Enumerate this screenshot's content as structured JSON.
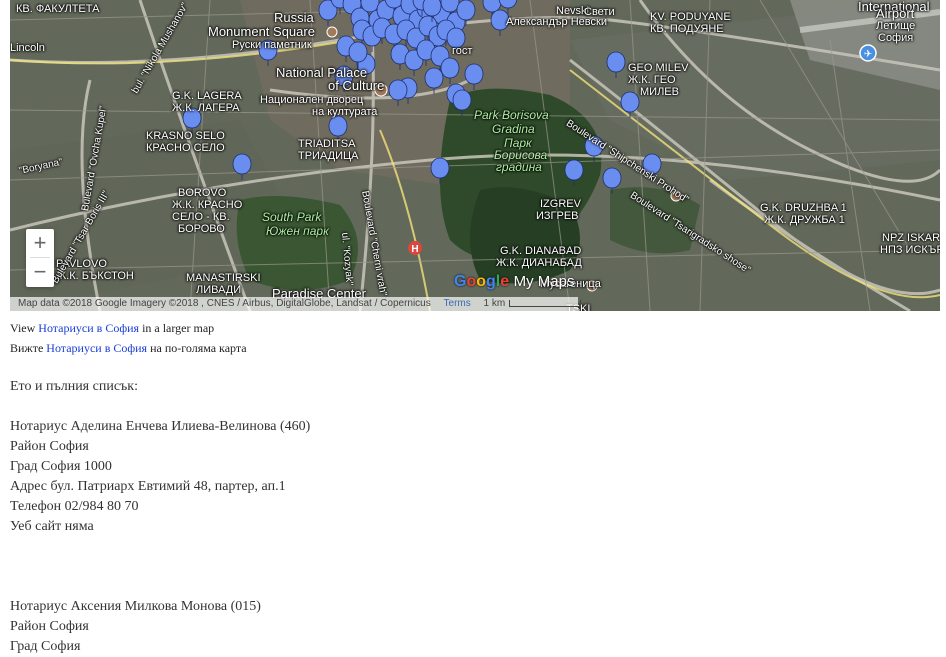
{
  "map": {
    "labels": {
      "fakulteta": "КВ. ФАКУЛТЕТА",
      "russian": "Russia",
      "monument_en": "Monument Square",
      "monument_bg": "Руски паметник",
      "national_palace_en": "National Palace",
      "national_palace_en2": "of Culture",
      "national_palace_bg": "Национален дворец",
      "national_palace_bg2": "на културата",
      "lagera_en": "G.K. LAGERA",
      "lagera_bg": "Ж.К. ЛАГЕРА",
      "krasno_en": "KRASNO SELO",
      "krasno_bg": "КРАСНО СЕЛО",
      "triaditsa_en": "TRIADITSA",
      "triaditsa_bg": "ТРИАДИЦА",
      "borovo_en": "BOROVO",
      "borovo_bg": "Ж.К. КРАСНО",
      "borovo_bg2": "СЕЛО - КВ.",
      "borovo_bg3": "БОРОВО",
      "south_park_en": "South Park",
      "south_park_bg": "Южен парк",
      "pavlovo_en": "PAVLOVO",
      "pavlovo_bg": "Ж.К. БЪКСТОН",
      "manastirski_en": "MANASTIRSKI",
      "manastirski_bg": "ЛИВАДИ",
      "paradise": "Paradise Center",
      "park_borisova_en": "Park Borisova",
      "park_borisova_en2": "Gradina",
      "park_borisova_bg": "Парк",
      "park_borisova_bg2": "Борисова",
      "park_borisova_bg3": "градина",
      "izgrev_en": "IZGREV",
      "izgrev_bg": "ИЗГРЕВ",
      "dianabad_en": "G.K. DIANABAD",
      "dianabad_bg": "Ж.К. ДИАНАБАД",
      "musagenitsa": "Мусагеница",
      "geo_milev_en": "GEO MILEV",
      "geo_milev_bg": "Ж.К. ГЕО",
      "geo_milev_bg2": "МИЛЕВ",
      "poduyane_en": "KV. PODUYANE",
      "poduyane_bg": "КВ. ПОДУЯНЕ",
      "druzhba_en": "G.K. DRUZHBA 1",
      "druzhba_bg": "Ж.К. ДРУЖБА 1",
      "nevski": "Александър Невски",
      "sveti": "Свети",
      "nevski_en": "Nevski",
      "airport_en": "International",
      "airport_en2": "Airport",
      "airport_bg": "Летище",
      "airport_bg2": "София",
      "npz_en": "NPZ ISKAR",
      "npz_bg": "НПЗ ИСКЪР",
      "shipchenski": "Boulevard \"Shipchenski Prohod\"",
      "tsarigradsko": "Boulevard \"Tsarigradsko shose\"",
      "cherni_vrah": "Boulevard \"Cherni vrah\"",
      "kozyak": "ul. \"Kozyak\"",
      "tsar_boris": "Bulevard \"Tsar Boris III\"",
      "boryana": "\"Boryana\"",
      "ovcha_kupel": "Bulevard \"Ovcha Kupel\"",
      "nikola_mushanov": "bul. \"Nikola Mushanov\"",
      "gost": "гост",
      "tsktisk": "TSKI",
      "lincoln": "Lincoln"
    },
    "zoom_in": "+",
    "zoom_out": "−",
    "attribution": "Map data ©2018 Google Imagery ©2018 , CNES / Airbus, DigitalGlobe, Landsat / Copernicus",
    "terms": "Terms",
    "scale": "1 km",
    "logo_google": [
      "G",
      "o",
      "o",
      "g",
      "l",
      "e"
    ],
    "logo_mymaps": "My Maps",
    "accent_pin": "#6a8df0"
  },
  "links": {
    "line1_prefix": "View",
    "line1_link": "Нотариуси в София",
    "line1_suffix": "in a larger map",
    "line2_prefix": "Вижте",
    "line2_link": "Нотариуси в София",
    "line2_suffix": "на по-голяма карта"
  },
  "intro": "Ето и пълния списък:",
  "entries": [
    {
      "name": "Нотариус Аделина Енчева Илиева-Велинова (460)",
      "region": "Район София",
      "city": "Град София 1000",
      "address": "Адрес бул. Патриарх Евтимий 48, партер, ап.1",
      "phone": "Телефон 02/984 80 70",
      "web": "Уеб сайт няма"
    },
    {
      "name": "Нотариус Аксения Милкова Монова (015)",
      "region": "Район София",
      "city": "Град София"
    }
  ]
}
